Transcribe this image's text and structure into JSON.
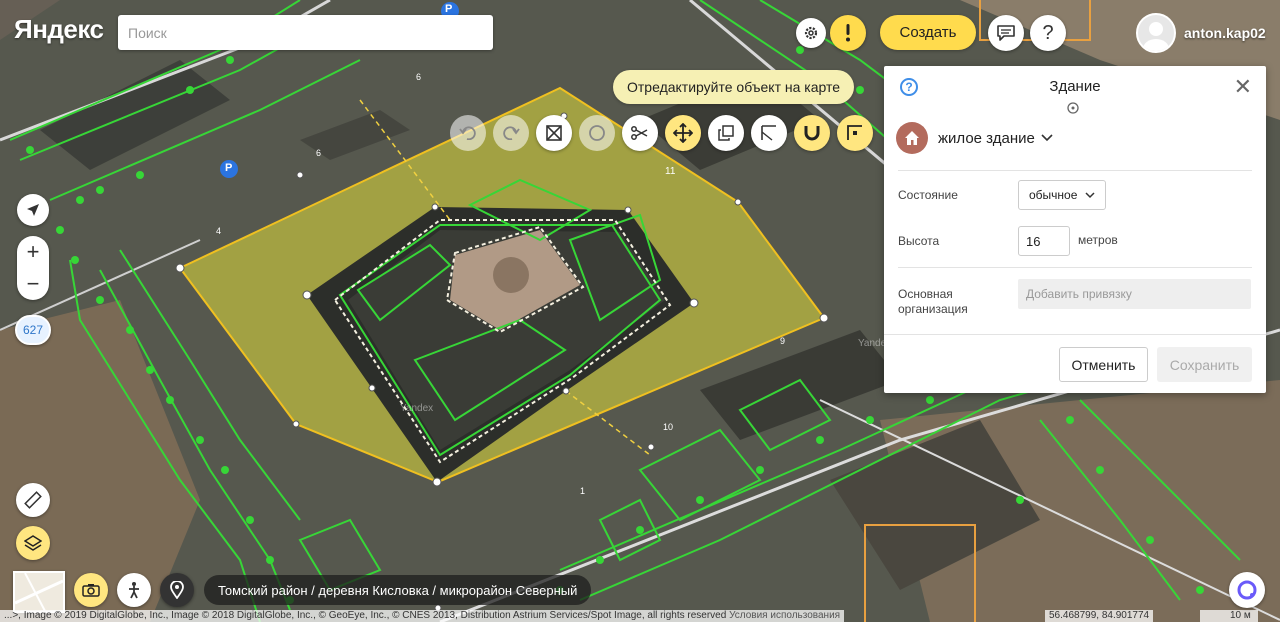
{
  "header": {
    "logo": "Яндекс",
    "search_placeholder": "Поиск",
    "create_label": "Создать",
    "username": "anton.kap02"
  },
  "hint": "Отредактируйте объект на карте",
  "tools": [
    "undo-icon",
    "redo-icon",
    "delete-vertices-icon",
    "circle-icon",
    "cut-icon",
    "move-icon",
    "copy-icon",
    "angle-icon",
    "magnet-icon",
    "square-snap-icon"
  ],
  "panel": {
    "title": "Здание",
    "category": "жилое здание",
    "state_label": "Состояние",
    "state_value": "обычное",
    "height_label": "Высота",
    "height_value": "16",
    "height_unit": "метров",
    "org_label": "Основная организация",
    "org_button": "Добавить привязку",
    "cancel_label": "Отменить",
    "save_label": "Сохранить"
  },
  "map": {
    "zoom_in": "+",
    "zoom_out": "−",
    "badge": "627",
    "labels": {
      "n11": "11",
      "n10": "10",
      "n9": "9",
      "n6a": "6",
      "n6b": "6",
      "n4": "4",
      "n1": "1",
      "p": "P",
      "yandex1": "Yandex",
      "yandex2": "Yandex"
    }
  },
  "breadcrumb": "Томский район / деревня Кисловка / микрорайон Северный",
  "footer": {
    "copyright": "...>, Image © 2019 DigitalGlobe, Inc., Image © 2018 DigitalGlobe, Inc., © GeoEye, Inc., © CNES 2013, Distribution Astrium Services/Spot Image, all rights reserved",
    "terms": "Условия использования",
    "coords": "56.468799, 84.901774",
    "scale": "10 м"
  },
  "colors": {
    "accent": "#ffdb4d",
    "selection": "#e8e05a",
    "roads": "#37d637",
    "brand_link": "#3f8ee8"
  }
}
